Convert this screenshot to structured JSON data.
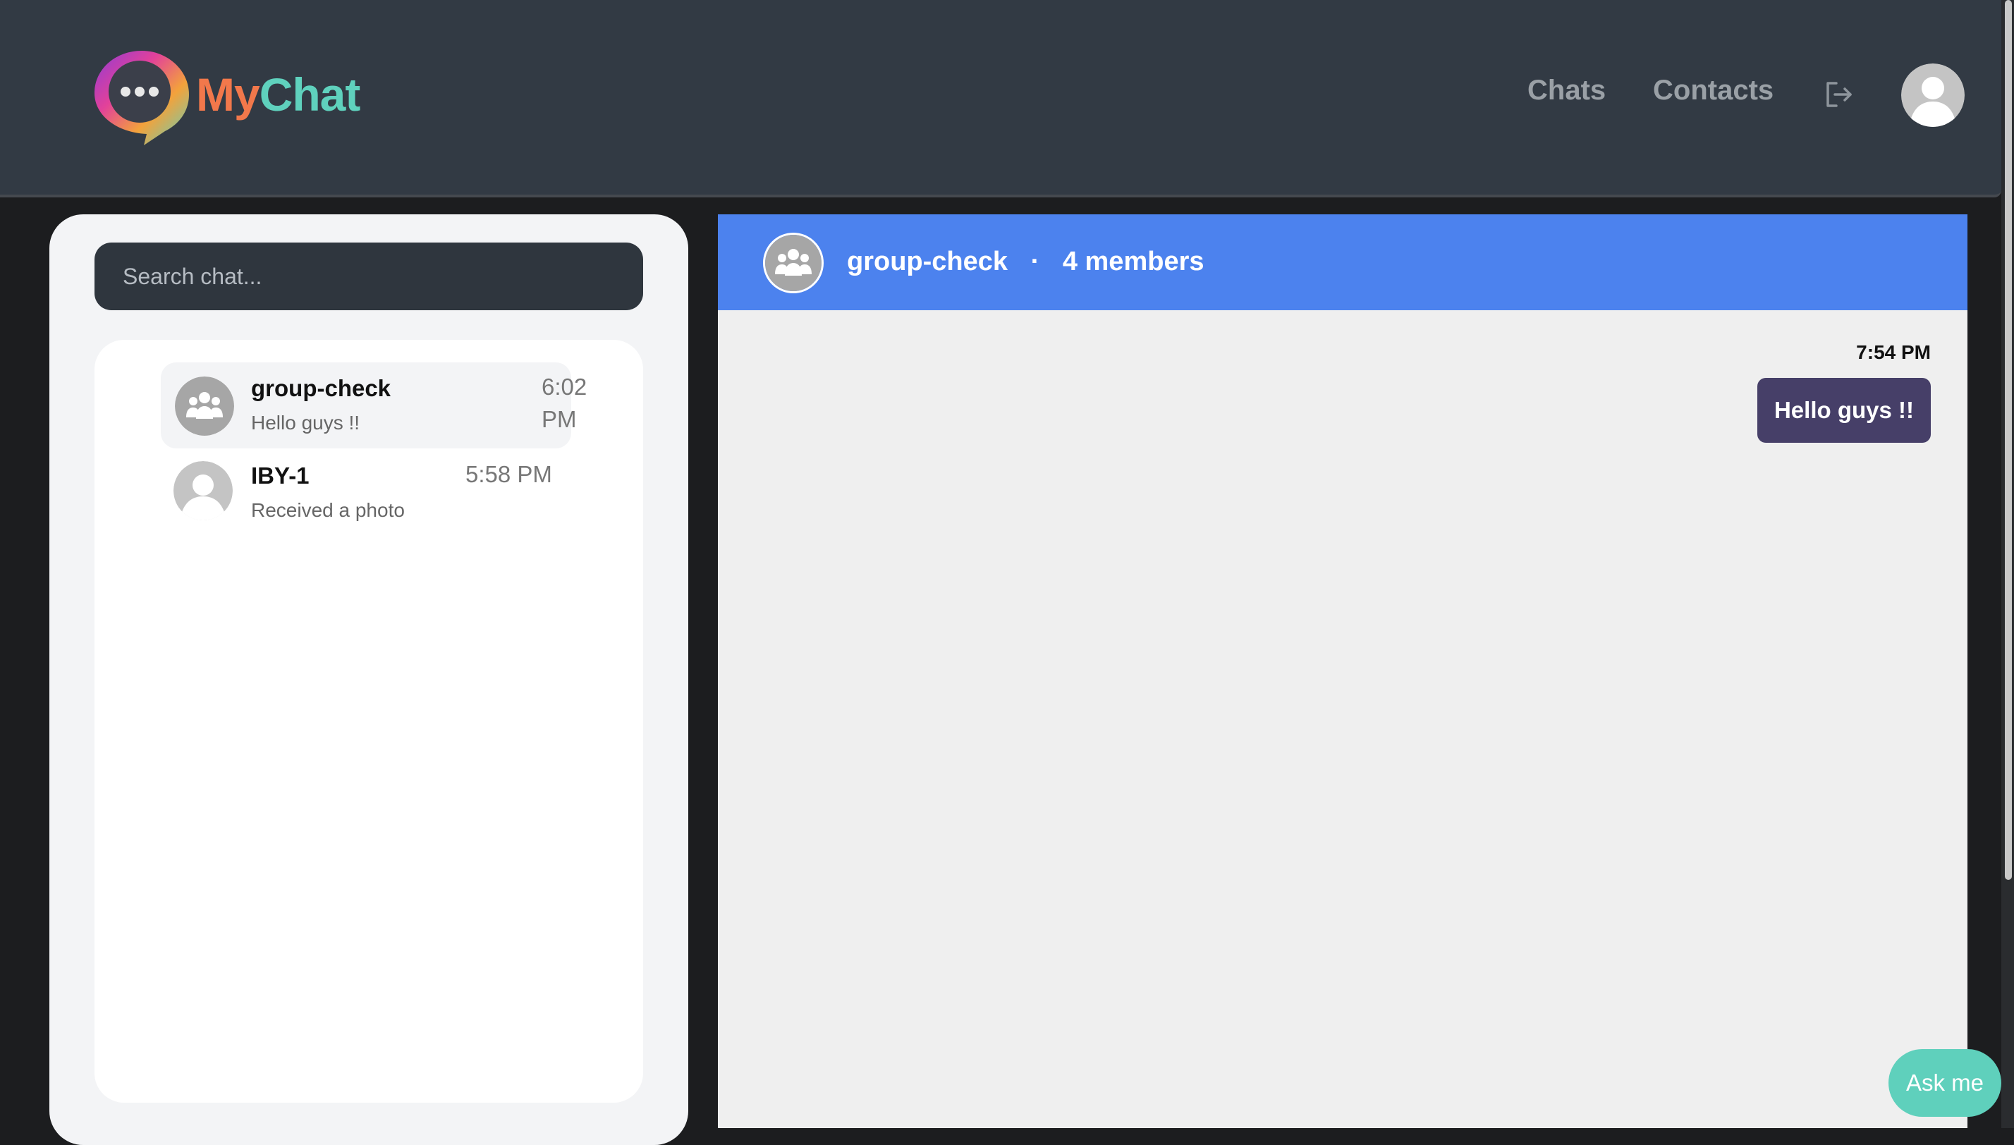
{
  "header": {
    "brand_my": "My",
    "brand_chat": "Chat",
    "nav_chats": "Chats",
    "nav_contacts": "Contacts",
    "logout_icon": "logout-icon",
    "profile_icon": "user-avatar-icon"
  },
  "sidebar": {
    "search_placeholder": "Search chat...",
    "chats": [
      {
        "name": "group-check",
        "preview": "Hello guys !!",
        "time": "6:02 PM",
        "avatar": "group-icon",
        "active": true
      },
      {
        "name": "IBY-1",
        "preview": "Received a photo",
        "time": "5:58 PM",
        "avatar": "user-avatar-icon",
        "active": false
      }
    ]
  },
  "chat": {
    "title": "group-check",
    "separator": "·",
    "members": "4 members",
    "messages": [
      {
        "time": "7:54 PM",
        "text": "Hello guys !!",
        "outgoing": true
      }
    ]
  },
  "assistant": {
    "label": "Ask me"
  },
  "colors": {
    "header_bg": "#323a44",
    "chat_header_bg": "#4c82ee",
    "bubble_bg": "#463f68",
    "ask_me_bg": "#5fd0bc",
    "brand_my": "#f2784b",
    "brand_chat": "#5fd1bd"
  }
}
